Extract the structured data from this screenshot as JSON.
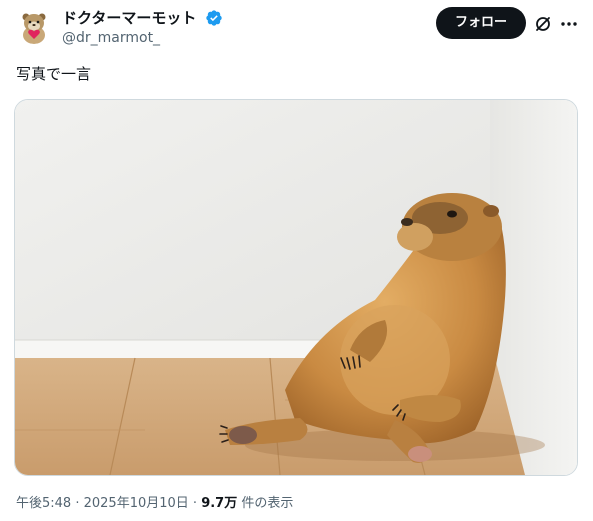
{
  "post": {
    "author": {
      "display_name": "ドクターマーモット",
      "handle": "@dr_marmot_",
      "verified": true,
      "avatar_icon": "marmot-avatar-icon"
    },
    "follow_label": "フォロー",
    "text": "写真で一言",
    "media": {
      "image_icon": "marmot-leaning-on-wall-photo"
    },
    "meta": {
      "time": "午後5:48",
      "separator_1": " · ",
      "date": "2025年10月10日",
      "separator_2": " · ",
      "views_count": "9.7万",
      "views_label": " 件の表示"
    }
  },
  "colors": {
    "text_primary": "#0f1419",
    "text_secondary": "#536471",
    "verified_blue": "#1d9bf0",
    "follow_bg": "#0f1419",
    "border": "#cfd9de"
  }
}
